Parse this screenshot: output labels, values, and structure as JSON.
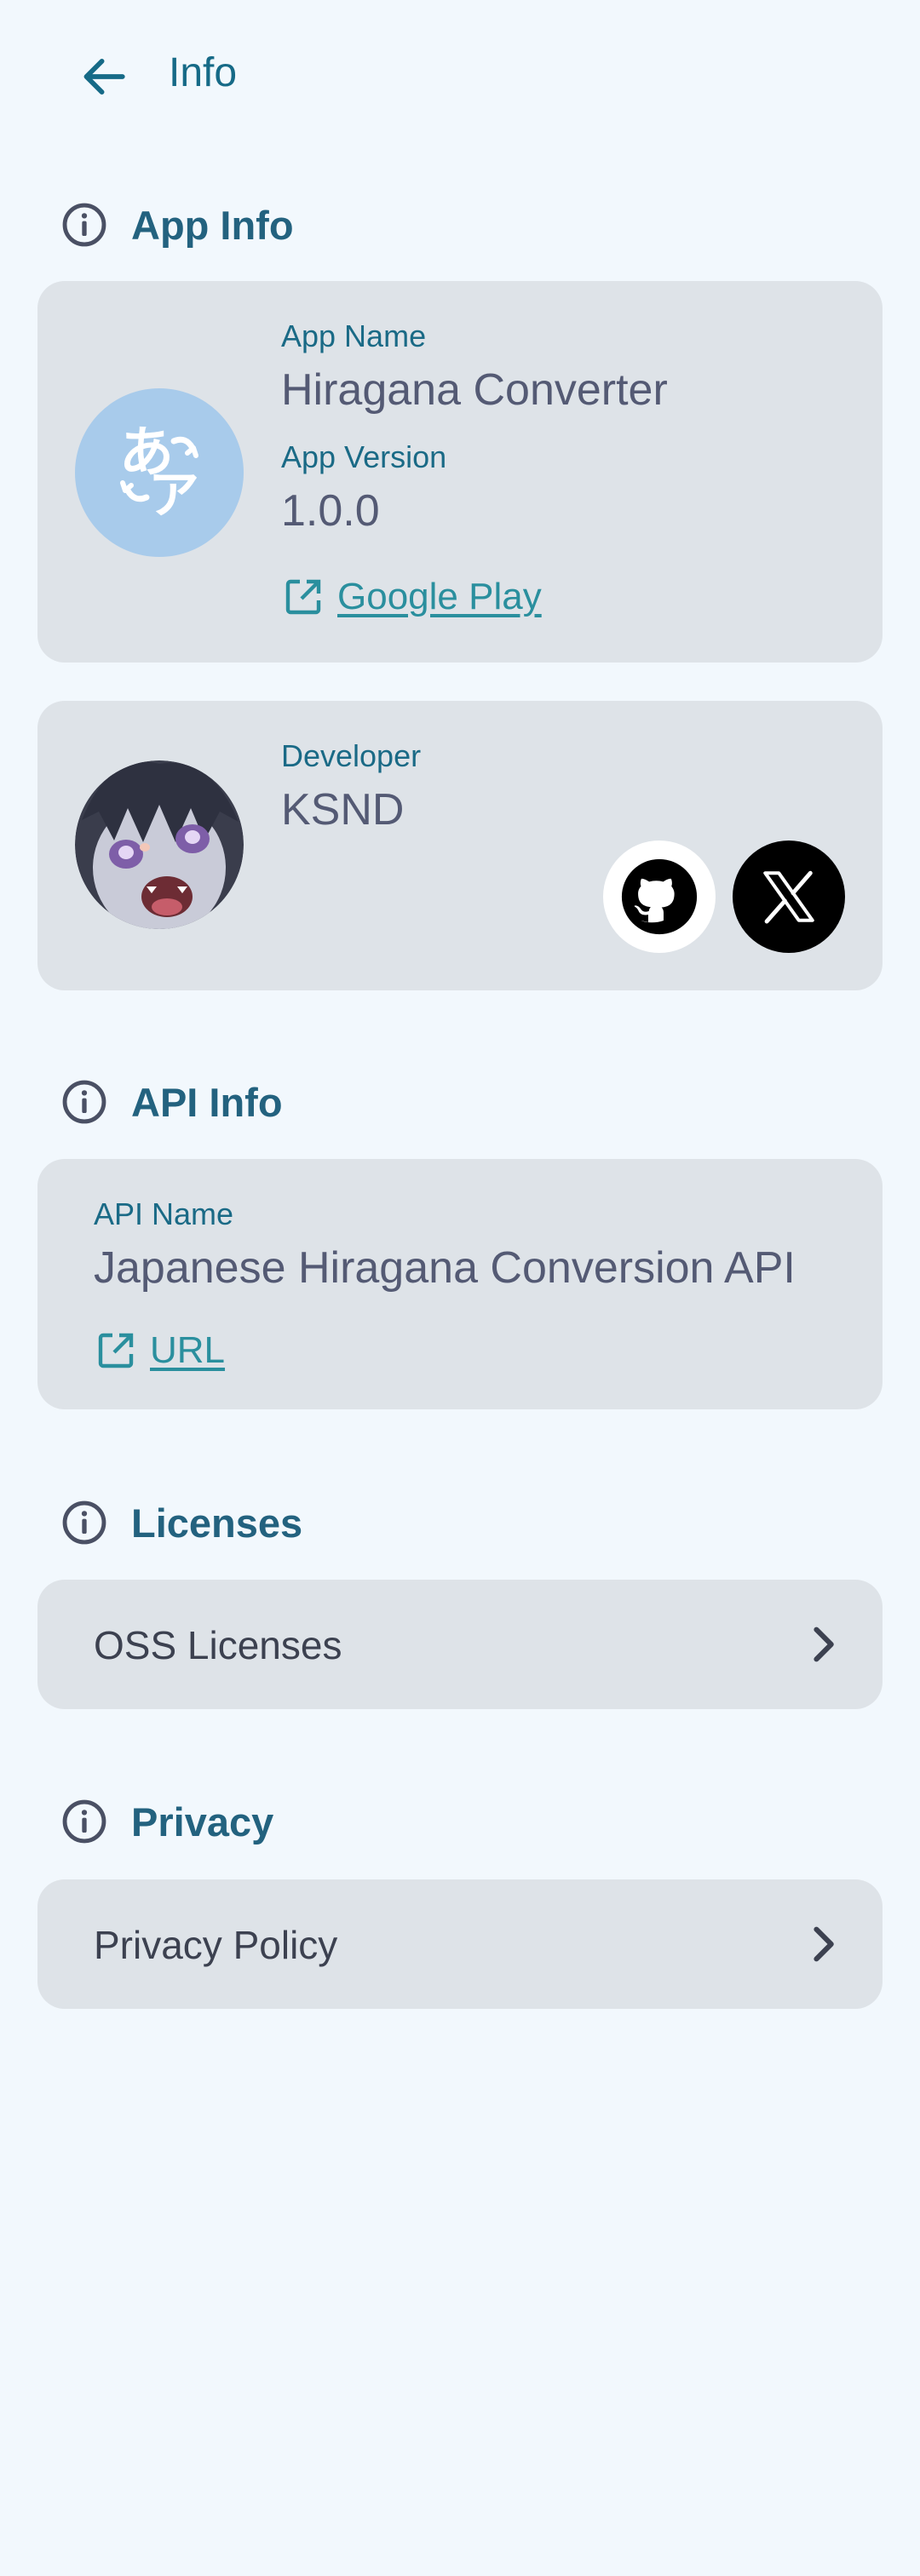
{
  "topbar": {
    "title": "Info",
    "back_icon": "arrow-back-icon"
  },
  "colors": {
    "background": "#F2F8FD",
    "card": "#DEE3E8",
    "accent": "#166A87",
    "link": "#2A8F9E",
    "app_icon_bg": "#A8CBEB"
  },
  "app_info": {
    "header": "App Info",
    "app_name_label": "App Name",
    "app_name": "Hiragana Converter",
    "app_version_label": "App Version",
    "app_version": "1.0.0",
    "store_link": "Google Play",
    "app_icon_glyph_top": "あ",
    "app_icon_glyph_bottom": "ア"
  },
  "developer": {
    "label": "Developer",
    "name": "KSND",
    "socials": [
      "github-icon",
      "x-icon"
    ]
  },
  "api_info": {
    "header": "API Info",
    "api_name_label": "API Name",
    "api_name": "Japanese Hiragana Conversion API",
    "url_link": "URL"
  },
  "licenses": {
    "header": "Licenses",
    "item": "OSS Licenses"
  },
  "privacy": {
    "header": "Privacy",
    "item": "Privacy Policy"
  }
}
